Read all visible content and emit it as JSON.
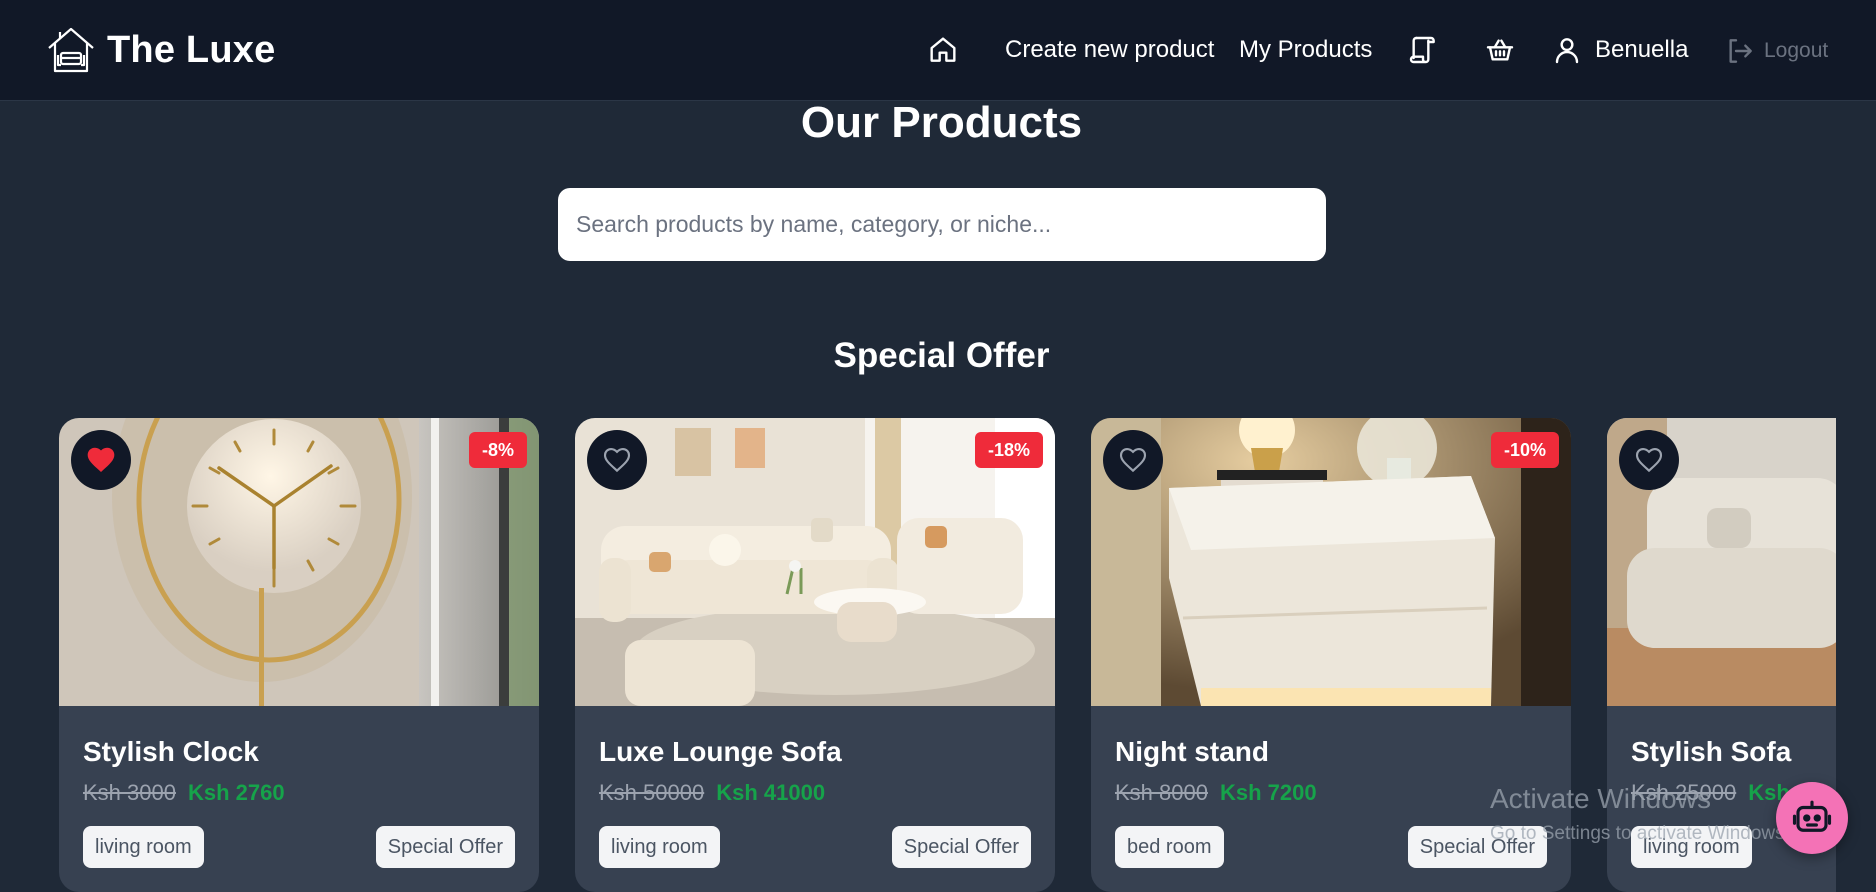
{
  "brand": {
    "name": "The Luxe",
    "logo_icon": "house-sofa-icon"
  },
  "nav": {
    "home_icon": "home-icon",
    "create_label": "Create new product",
    "my_products_label": "My Products",
    "orders_icon": "scroll-icon",
    "cart_icon": "basket-icon",
    "user_icon": "user-icon",
    "user_name": "Benuella",
    "logout_label": "Logout",
    "logout_icon": "logout-icon"
  },
  "page": {
    "title": "Our Products",
    "search_placeholder": "Search products by name, category, or niche...",
    "section_title": "Special Offer"
  },
  "products": [
    {
      "name": "Stylish Clock",
      "old_price": "Ksh 3000",
      "new_price": "Ksh 2760",
      "discount": "-8%",
      "category": "living room",
      "tag": "Special Offer",
      "favorited": true
    },
    {
      "name": "Luxe Lounge Sofa",
      "old_price": "Ksh 50000",
      "new_price": "Ksh 41000",
      "discount": "-18%",
      "category": "living room",
      "tag": "Special Offer",
      "favorited": false
    },
    {
      "name": "Night stand",
      "old_price": "Ksh 8000",
      "new_price": "Ksh 7200",
      "discount": "-10%",
      "category": "bed room",
      "tag": "Special Offer",
      "favorited": false
    },
    {
      "name": "Stylish Sofa",
      "old_price": "Ksh 25000",
      "new_price": "Ksh 2",
      "discount": "",
      "category": "living room",
      "tag": "",
      "favorited": false
    }
  ],
  "watermark": {
    "title": "Activate Windows",
    "subtitle": "Go to Settings to activate Windows."
  },
  "colors": {
    "background": "#1f2937",
    "navbar": "#111827",
    "card": "#374151",
    "discount": "#ef2b3a",
    "price_green": "#16a34a",
    "bot_button": "#f472b6"
  }
}
